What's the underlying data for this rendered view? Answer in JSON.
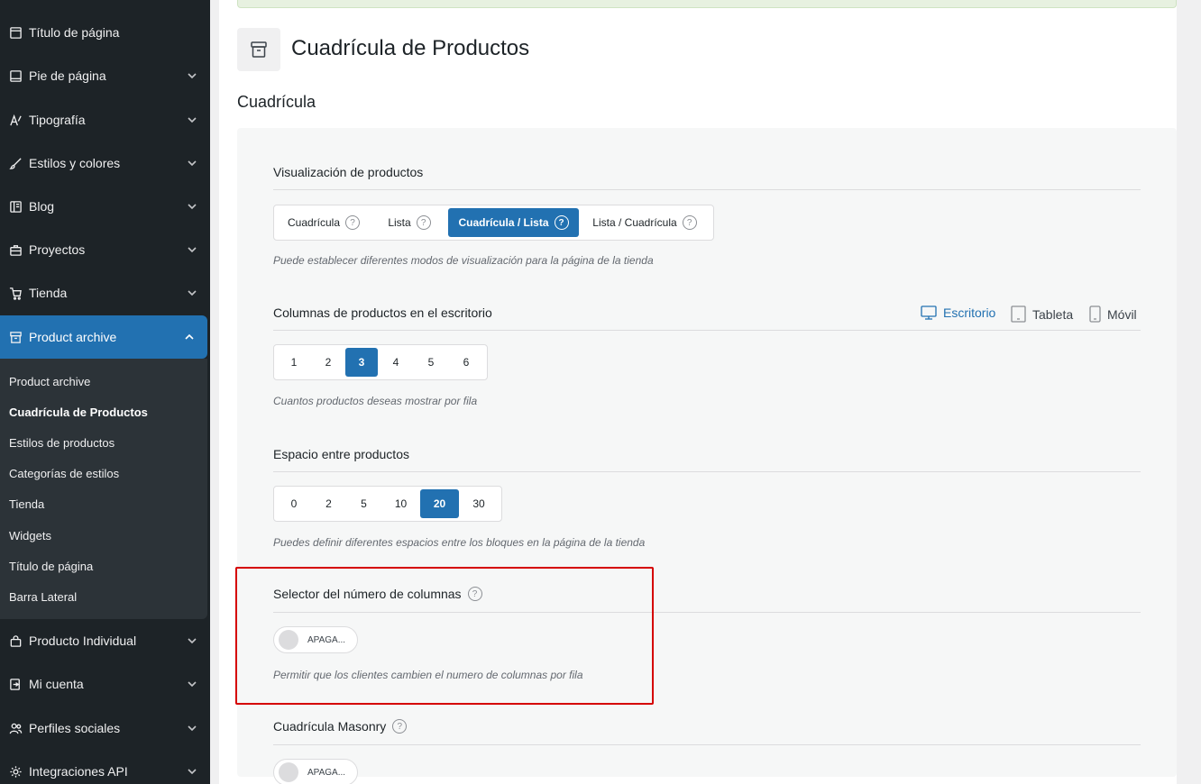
{
  "sidebar": {
    "items": [
      {
        "label": "Título de página",
        "icon": "page-title-icon"
      },
      {
        "label": "Pie de página",
        "icon": "footer-icon"
      },
      {
        "label": "Tipografía",
        "icon": "typography-icon"
      },
      {
        "label": "Estilos y colores",
        "icon": "brush-icon"
      },
      {
        "label": "Blog",
        "icon": "blog-icon"
      },
      {
        "label": "Proyectos",
        "icon": "briefcase-icon"
      },
      {
        "label": "Tienda",
        "icon": "cart-icon"
      },
      {
        "label": "Product archive",
        "icon": "archive-icon"
      },
      {
        "label": "Producto Individual",
        "icon": "bag-icon"
      },
      {
        "label": "Mi cuenta",
        "icon": "account-icon"
      },
      {
        "label": "Perfiles sociales",
        "icon": "users-icon"
      },
      {
        "label": "Integraciones API",
        "icon": "gear-icon"
      }
    ],
    "submenu": [
      "Product archive",
      "Cuadrícula de Productos",
      "Estilos de productos",
      "Categorías de estilos",
      "Tienda",
      "Widgets",
      "Título de página",
      "Barra Lateral"
    ],
    "active_item": "Product archive",
    "current_subitem": "Cuadrícula de Productos"
  },
  "main": {
    "page_title": "Cuadrícula de Productos",
    "section_title": "Cuadrícula",
    "product_display": {
      "label": "Visualización de productos",
      "options": [
        "Cuadrícula",
        "Lista",
        "Cuadrícula / Lista",
        "Lista / Cuadrícula"
      ],
      "selected": "Cuadrícula / Lista",
      "description": "Puede establecer diferentes modos de visualización para la página de la tienda"
    },
    "desktop_columns": {
      "label": "Columnas de productos en el escritorio",
      "devices": [
        "Escritorio",
        "Tableta",
        "Móvil"
      ],
      "active_device": "Escritorio",
      "options": [
        "1",
        "2",
        "3",
        "4",
        "5",
        "6"
      ],
      "selected": "3",
      "description": "Cuantos productos deseas mostrar por fila"
    },
    "product_spacing": {
      "label": "Espacio entre productos",
      "options": [
        "0",
        "2",
        "5",
        "10",
        "20",
        "30"
      ],
      "selected": "20",
      "description": "Puedes definir diferentes espacios entre los bloques en la página de la tienda"
    },
    "column_selector": {
      "label": "Selector del número de columnas",
      "toggle_text": "APAGA...",
      "enabled": false,
      "description": "Permitir que los clientes cambien el numero de columnas por fila"
    },
    "masonry_grid": {
      "label": "Cuadrícula Masonry",
      "toggle_text": "APAGA...",
      "enabled": false
    }
  },
  "colors": {
    "sidebar_bg": "#1d2327",
    "accent": "#2271b1",
    "highlight_border": "#d50000"
  }
}
